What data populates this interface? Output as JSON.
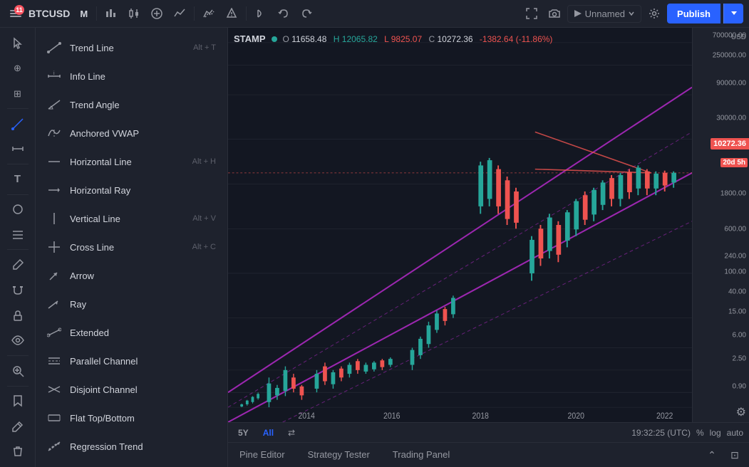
{
  "toolbar": {
    "symbol": "BTCUSD",
    "timeframe": "M",
    "publish_label": "Publish",
    "unnamed_label": "Unnamed",
    "notification_count": "11"
  },
  "ohlc": {
    "exchange": "STAMP",
    "open_label": "O",
    "open_val": "11658.48",
    "high_label": "H",
    "high_val": "12065.82",
    "low_label": "L",
    "low_val": "9825.07",
    "close_label": "C",
    "close_val": "10272.36",
    "change": "-1382.64 (-11.86%)"
  },
  "drawing_tools": [
    {
      "id": "trend-line",
      "label": "Trend Line",
      "shortcut": "Alt + T",
      "icon": "trend"
    },
    {
      "id": "info-line",
      "label": "Info Line",
      "shortcut": "",
      "icon": "info"
    },
    {
      "id": "trend-angle",
      "label": "Trend Angle",
      "shortcut": "",
      "icon": "angle"
    },
    {
      "id": "anchored-vwap",
      "label": "Anchored VWAP",
      "shortcut": "",
      "icon": "vwap"
    },
    {
      "id": "horizontal-line",
      "label": "Horizontal Line",
      "shortcut": "Alt + H",
      "icon": "hline"
    },
    {
      "id": "horizontal-ray",
      "label": "Horizontal Ray",
      "shortcut": "",
      "icon": "hray"
    },
    {
      "id": "vertical-line",
      "label": "Vertical Line",
      "shortcut": "Alt + V",
      "icon": "vline"
    },
    {
      "id": "cross-line",
      "label": "Cross Line",
      "shortcut": "Alt + C",
      "icon": "cross"
    },
    {
      "id": "arrow",
      "label": "Arrow",
      "shortcut": "",
      "icon": "arrow"
    },
    {
      "id": "ray",
      "label": "Ray",
      "shortcut": "",
      "icon": "ray"
    },
    {
      "id": "extended",
      "label": "Extended",
      "shortcut": "",
      "icon": "extended"
    },
    {
      "id": "parallel-channel",
      "label": "Parallel Channel",
      "shortcut": "",
      "icon": "parallel"
    },
    {
      "id": "disjoint-channel",
      "label": "Disjoint Channel",
      "shortcut": "",
      "icon": "disjoint"
    },
    {
      "id": "flat-top-bottom",
      "label": "Flat Top/Bottom",
      "shortcut": "",
      "icon": "flat"
    },
    {
      "id": "regression-trend",
      "label": "Regression Trend",
      "shortcut": "",
      "icon": "regression"
    }
  ],
  "price_axis": {
    "current_price": "10272.36",
    "time_badge": "20d 5h",
    "levels": [
      {
        "price": "700000.00",
        "pct": 2
      },
      {
        "price": "250000.00",
        "pct": 7
      },
      {
        "price": "90000.00",
        "pct": 14
      },
      {
        "price": "30000.00",
        "pct": 23
      },
      {
        "price": "1800.00",
        "pct": 42
      },
      {
        "price": "600.00",
        "pct": 51
      },
      {
        "price": "240.00",
        "pct": 58
      },
      {
        "price": "100.00",
        "pct": 62
      },
      {
        "price": "40.00",
        "pct": 67
      },
      {
        "price": "15.00",
        "pct": 72
      },
      {
        "price": "6.00",
        "pct": 78
      },
      {
        "price": "2.50",
        "pct": 84
      },
      {
        "price": "0.90",
        "pct": 91
      }
    ]
  },
  "bottom_bar": {
    "periods": [
      "5Y",
      "All"
    ],
    "active_period": "All",
    "time": "19:32:25 (UTC)",
    "percent_label": "%",
    "log_label": "log",
    "auto_label": "auto"
  },
  "bottom_tabs": [
    {
      "id": "pine-editor",
      "label": "Pine Editor",
      "active": false
    },
    {
      "id": "strategy-tester",
      "label": "Strategy Tester",
      "active": false
    },
    {
      "id": "trading-panel",
      "label": "Trading Panel",
      "active": false
    }
  ],
  "timeline": {
    "labels": [
      "2014",
      "2016",
      "2018",
      "2020",
      "2022"
    ]
  },
  "colors": {
    "accent": "#2962ff",
    "bull": "#26a69a",
    "bear": "#ef5350",
    "channel": "#9c27b0",
    "bg": "#131722"
  }
}
